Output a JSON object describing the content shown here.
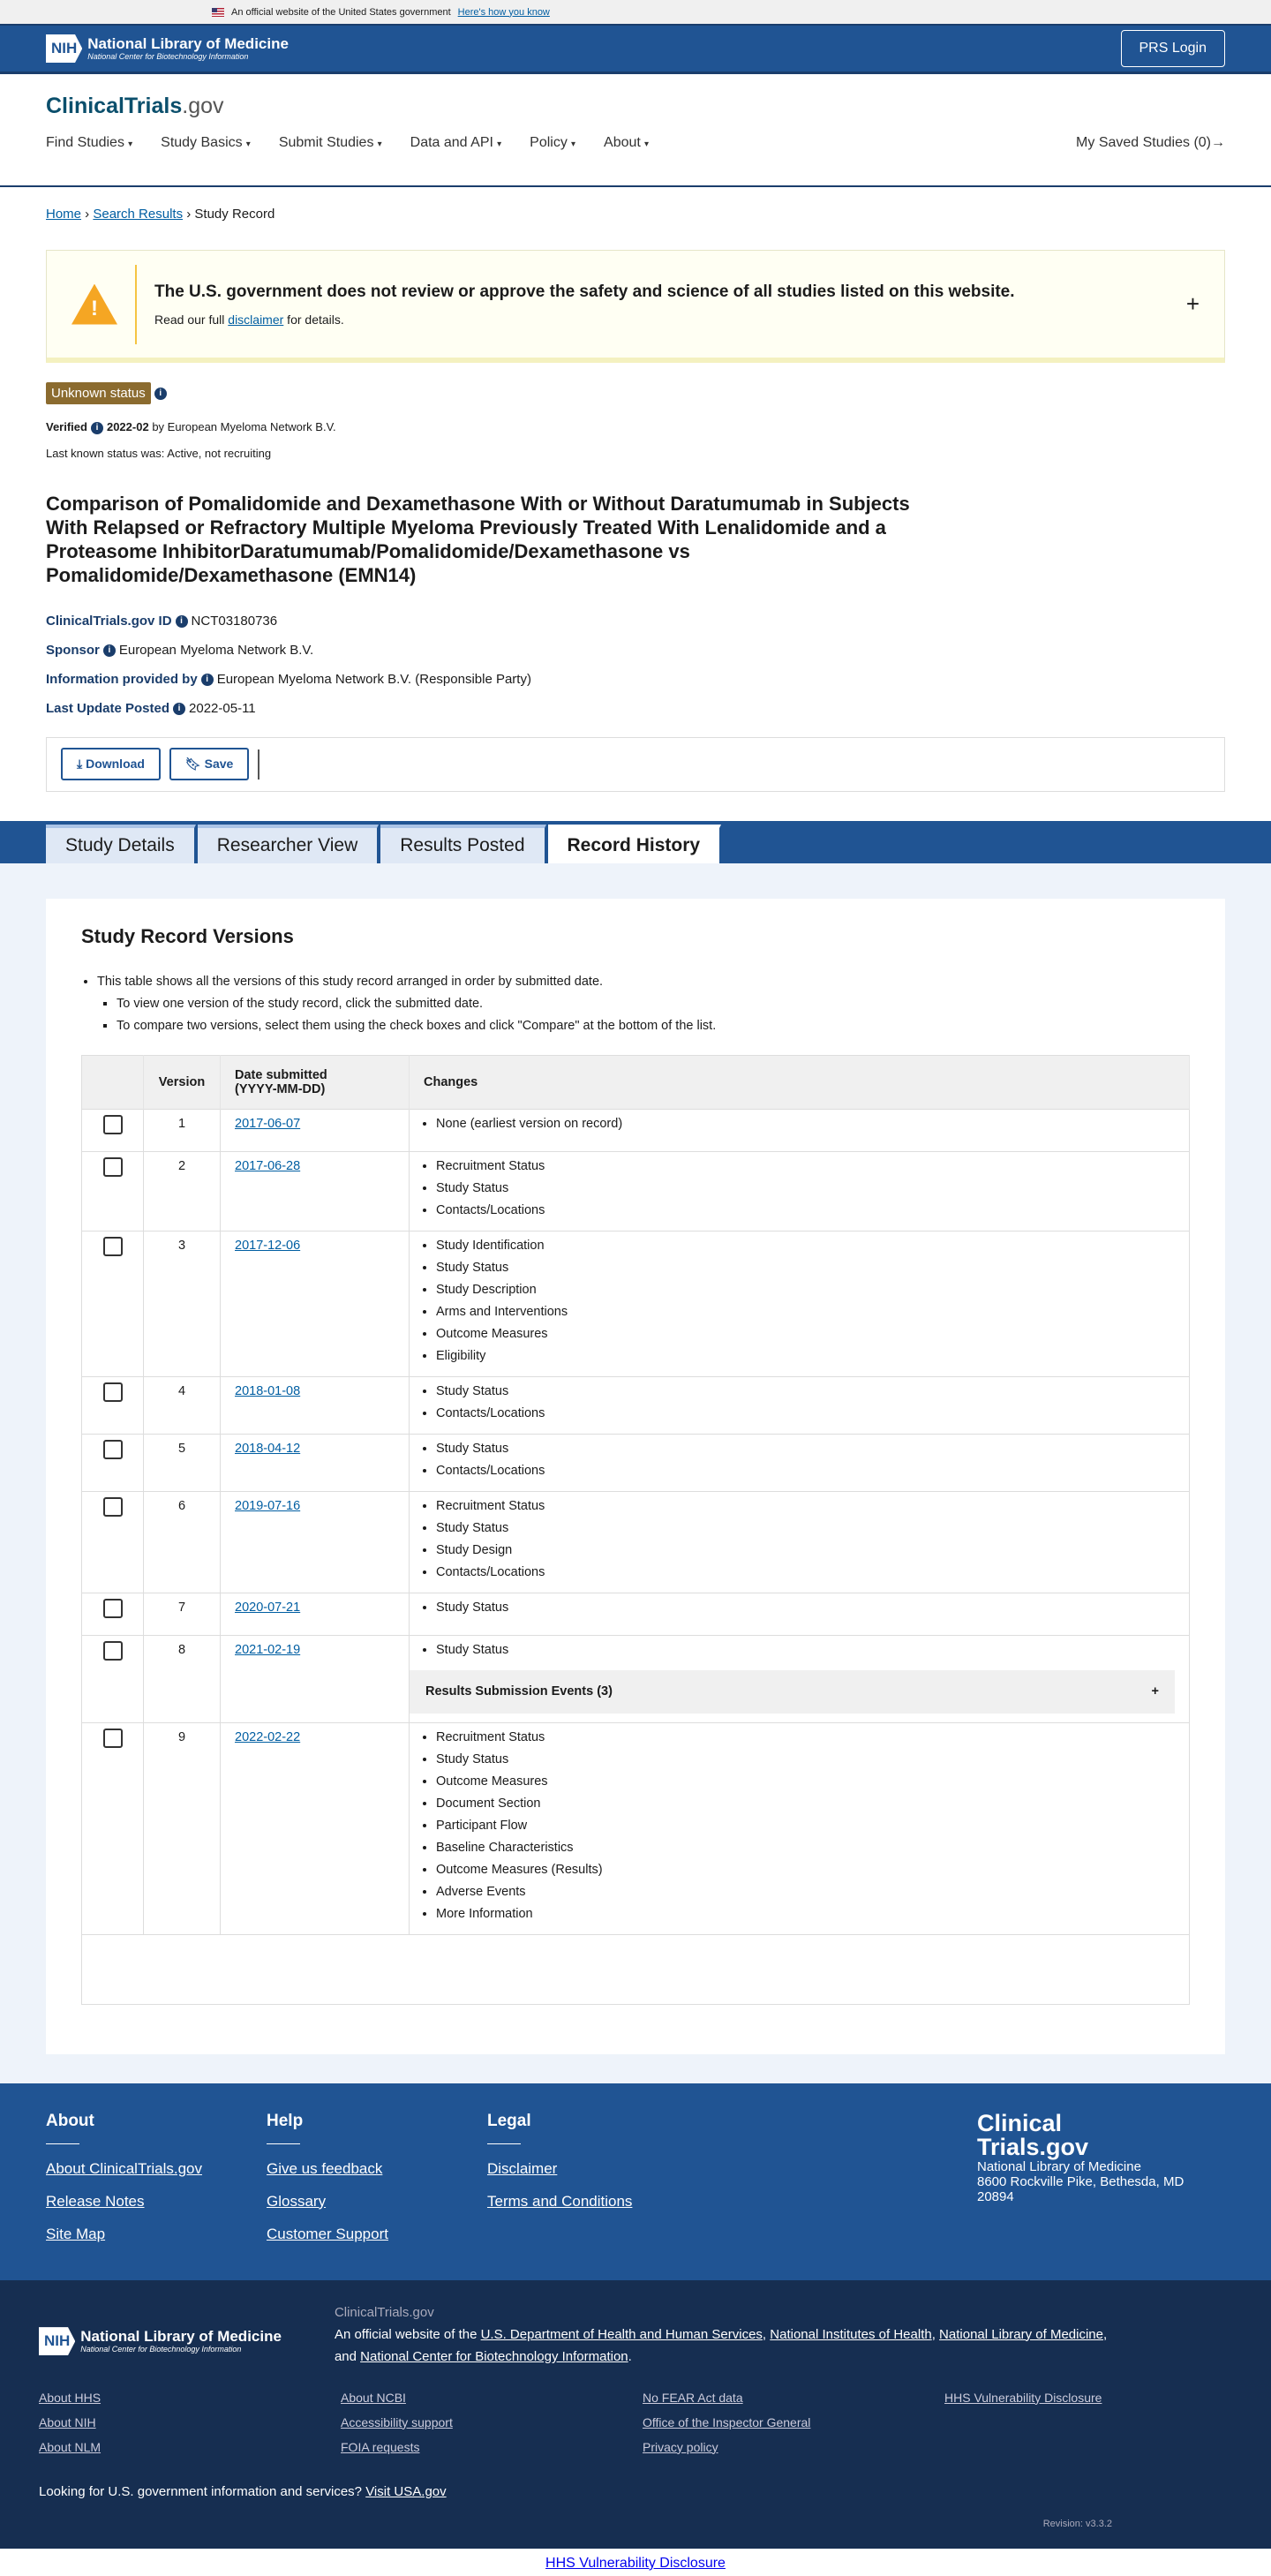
{
  "gov_banner": {
    "text": "An official website of the United States government",
    "link": "Here's how you know"
  },
  "header": {
    "org": "National Library of Medicine",
    "sub": "National Center for Biotechnology Information",
    "nih": "NIH",
    "login": "PRS Login"
  },
  "brand": {
    "a": "ClinicalTrials",
    "b": ".gov"
  },
  "nav": {
    "items": [
      "Find Studies",
      "Study Basics",
      "Submit Studies",
      "Data and API",
      "Policy",
      "About"
    ],
    "saved": "My Saved Studies (0)→"
  },
  "breadcrumb": {
    "home": "Home",
    "search": "Search Results",
    "current": "Study Record"
  },
  "disclaimer": {
    "title": "The U.S. government does not review or approve the safety and science of all studies listed on this website.",
    "pre": "Read our full ",
    "link": "disclaimer",
    "post": " for details."
  },
  "status": {
    "badge": "Unknown status",
    "verified_label": "Verified",
    "verified_date": "2022-02",
    "verified_by": "by European Myeloma Network B.V.",
    "last_known": "Last known status was: Active, not recruiting"
  },
  "title": "Comparison of Pomalidomide and Dexamethasone With or Without Daratumumab in Subjects With Relapsed or Refractory Multiple Myeloma Previously Treated With Lenalidomide and a Proteasome InhibitorDaratumumab/Pomalidomide/Dexamethasone vs Pomalidomide/Dexamethasone (EMN14)",
  "fields": [
    {
      "label": "ClinicalTrials.gov ID",
      "value": "NCT03180736"
    },
    {
      "label": "Sponsor",
      "value": "European Myeloma Network B.V."
    },
    {
      "label": "Information provided by",
      "value": "European Myeloma Network B.V. (Responsible Party)"
    },
    {
      "label": "Last Update Posted",
      "value": "2022-05-11"
    }
  ],
  "actions": {
    "download": "Download",
    "save": "Save"
  },
  "tabs": [
    "Study Details",
    "Researcher View",
    "Results Posted",
    "Record History"
  ],
  "versions": {
    "heading": "Study Record Versions",
    "notes": [
      "This table shows all the versions of this study record arranged in order by submitted date.",
      "To view one version of the study record, click the submitted date.",
      "To compare two versions, select them using the check boxes and click \"Compare\" at the bottom of the list."
    ],
    "columns": [
      "Version",
      "Date submitted",
      "(YYYY-MM-DD)",
      "Changes"
    ],
    "rows": [
      {
        "v": "1",
        "date": "2017-06-07",
        "changes": [
          "None (earliest version on record)"
        ]
      },
      {
        "v": "2",
        "date": "2017-06-28",
        "changes": [
          "Recruitment Status",
          "Study Status",
          "Contacts/Locations"
        ]
      },
      {
        "v": "3",
        "date": "2017-12-06",
        "changes": [
          "Study Identification",
          "Study Status",
          "Study Description",
          "Arms and Interventions",
          "Outcome Measures",
          "Eligibility"
        ]
      },
      {
        "v": "4",
        "date": "2018-01-08",
        "changes": [
          "Study Status",
          "Contacts/Locations"
        ]
      },
      {
        "v": "5",
        "date": "2018-04-12",
        "changes": [
          "Study Status",
          "Contacts/Locations"
        ]
      },
      {
        "v": "6",
        "date": "2019-07-16",
        "changes": [
          "Recruitment Status",
          "Study Status",
          "Study Design",
          "Contacts/Locations"
        ]
      },
      {
        "v": "7",
        "date": "2020-07-21",
        "changes": [
          "Study Status"
        ]
      },
      {
        "v": "8",
        "date": "2021-02-19",
        "changes": [
          "Study Status"
        ],
        "events": "Results Submission Events (3)"
      },
      {
        "v": "9",
        "date": "2022-02-22",
        "changes": [
          "Recruitment Status",
          "Study Status",
          "Outcome Measures",
          "Document Section",
          "Participant Flow",
          "Baseline Characteristics",
          "Outcome Measures (Results)",
          "Adverse Events",
          "More Information"
        ]
      }
    ]
  },
  "footer": {
    "cols": [
      {
        "h": "About",
        "links": [
          "About ClinicalTrials.gov",
          "Release Notes",
          "Site Map"
        ]
      },
      {
        "h": "Help",
        "links": [
          "Give us feedback",
          "Glossary",
          "Customer Support"
        ]
      },
      {
        "h": "Legal",
        "links": [
          "Disclaimer",
          "Terms and Conditions"
        ]
      }
    ],
    "logo": [
      "Clinical",
      "Trials.gov"
    ],
    "address": [
      "National Library of Medicine",
      "8600 Rockville Pike, Bethesda, MD",
      "20894"
    ],
    "site": "ClinicalTrials.gov",
    "official_pre": "An official website of the ",
    "official_links": [
      "U.S. Department of Health and Human Services",
      "National Institutes of Health",
      "National Library of Medicine",
      "National Center for Biotechnology Information"
    ],
    "and": "and ",
    "links": [
      "About HHS",
      "About NCBI",
      "No FEAR Act data",
      "HHS Vulnerability Disclosure",
      "About NIH",
      "Accessibility support",
      "Office of the Inspector General",
      "",
      "About NLM",
      "FOIA requests",
      "Privacy policy",
      ""
    ],
    "usa_text": "Looking for U.S. government information and services?",
    "usa_link": "Visit USA.gov",
    "revision": "Revision: v3.3.2",
    "hhs": "HHS Vulnerability Disclosure"
  }
}
